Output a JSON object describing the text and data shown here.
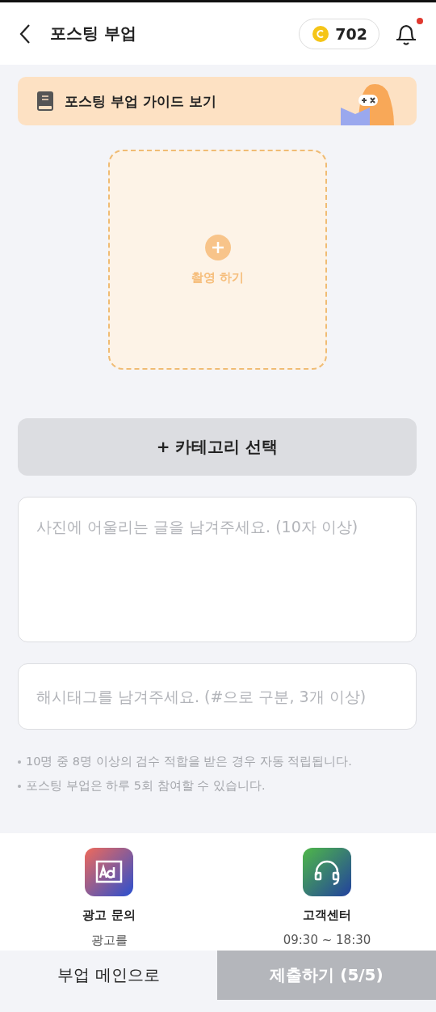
{
  "header": {
    "title": "포스팅 부업",
    "coins": "702",
    "has_notification": true
  },
  "guide_banner": {
    "label": "포스팅 부업 가이드 보기"
  },
  "upload": {
    "label": "촬영 하기"
  },
  "category_button": {
    "label": "+ 카테고리 선택"
  },
  "content_field": {
    "placeholder": "사진에 어울리는 글을 남겨주세요. (10자 이상)"
  },
  "hashtag_field": {
    "placeholder": "해시태그를 남겨주세요. (#으로 구분, 3개 이상)"
  },
  "notes": [
    "10명 중 8명 이상의 검수 적합을 받은 경우 자동 적립됩니다.",
    "포스팅 부업은 하루 5회 참여할 수 있습니다."
  ],
  "contacts": [
    {
      "kind": "ad",
      "title": "광고 문의",
      "subtitle": "광고를"
    },
    {
      "kind": "support",
      "title": "고객센터",
      "subtitle": "09:30 ~ 18:30"
    }
  ],
  "bottom_buttons": [
    {
      "label": "부업 메인으로",
      "disabled": false
    },
    {
      "label": "제출하기 (5/5)",
      "disabled": true
    }
  ]
}
